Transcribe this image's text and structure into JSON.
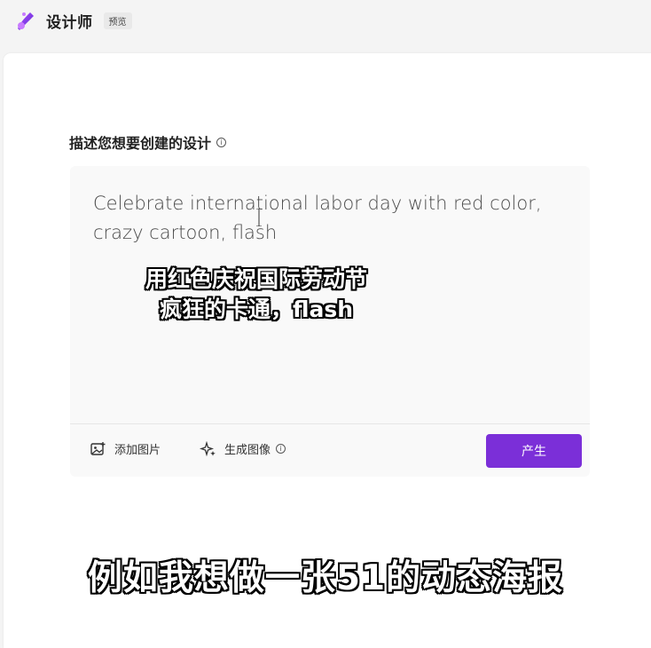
{
  "app": {
    "title": "设计师",
    "badge": "预览"
  },
  "prompt": {
    "label": "描述您想要创建的设计",
    "info_icon": "info-icon",
    "text": "Celebrate international labor day with red color, crazy cartoon, flash"
  },
  "toolbar": {
    "add_image_label": "添加图片",
    "add_image_icon": "add-image-icon",
    "generate_image_label": "生成图像",
    "generate_image_icon": "sparkle-icon",
    "generate_button_label": "产生"
  },
  "subtitles": {
    "line1": "用红色庆祝国际劳动节",
    "line2": "疯狂的卡通，flash",
    "bottom": "例如我想做一张51的动态海报"
  },
  "colors": {
    "accent": "#7b2fd8",
    "background": "#f4f4f4",
    "panel": "#ffffff"
  }
}
